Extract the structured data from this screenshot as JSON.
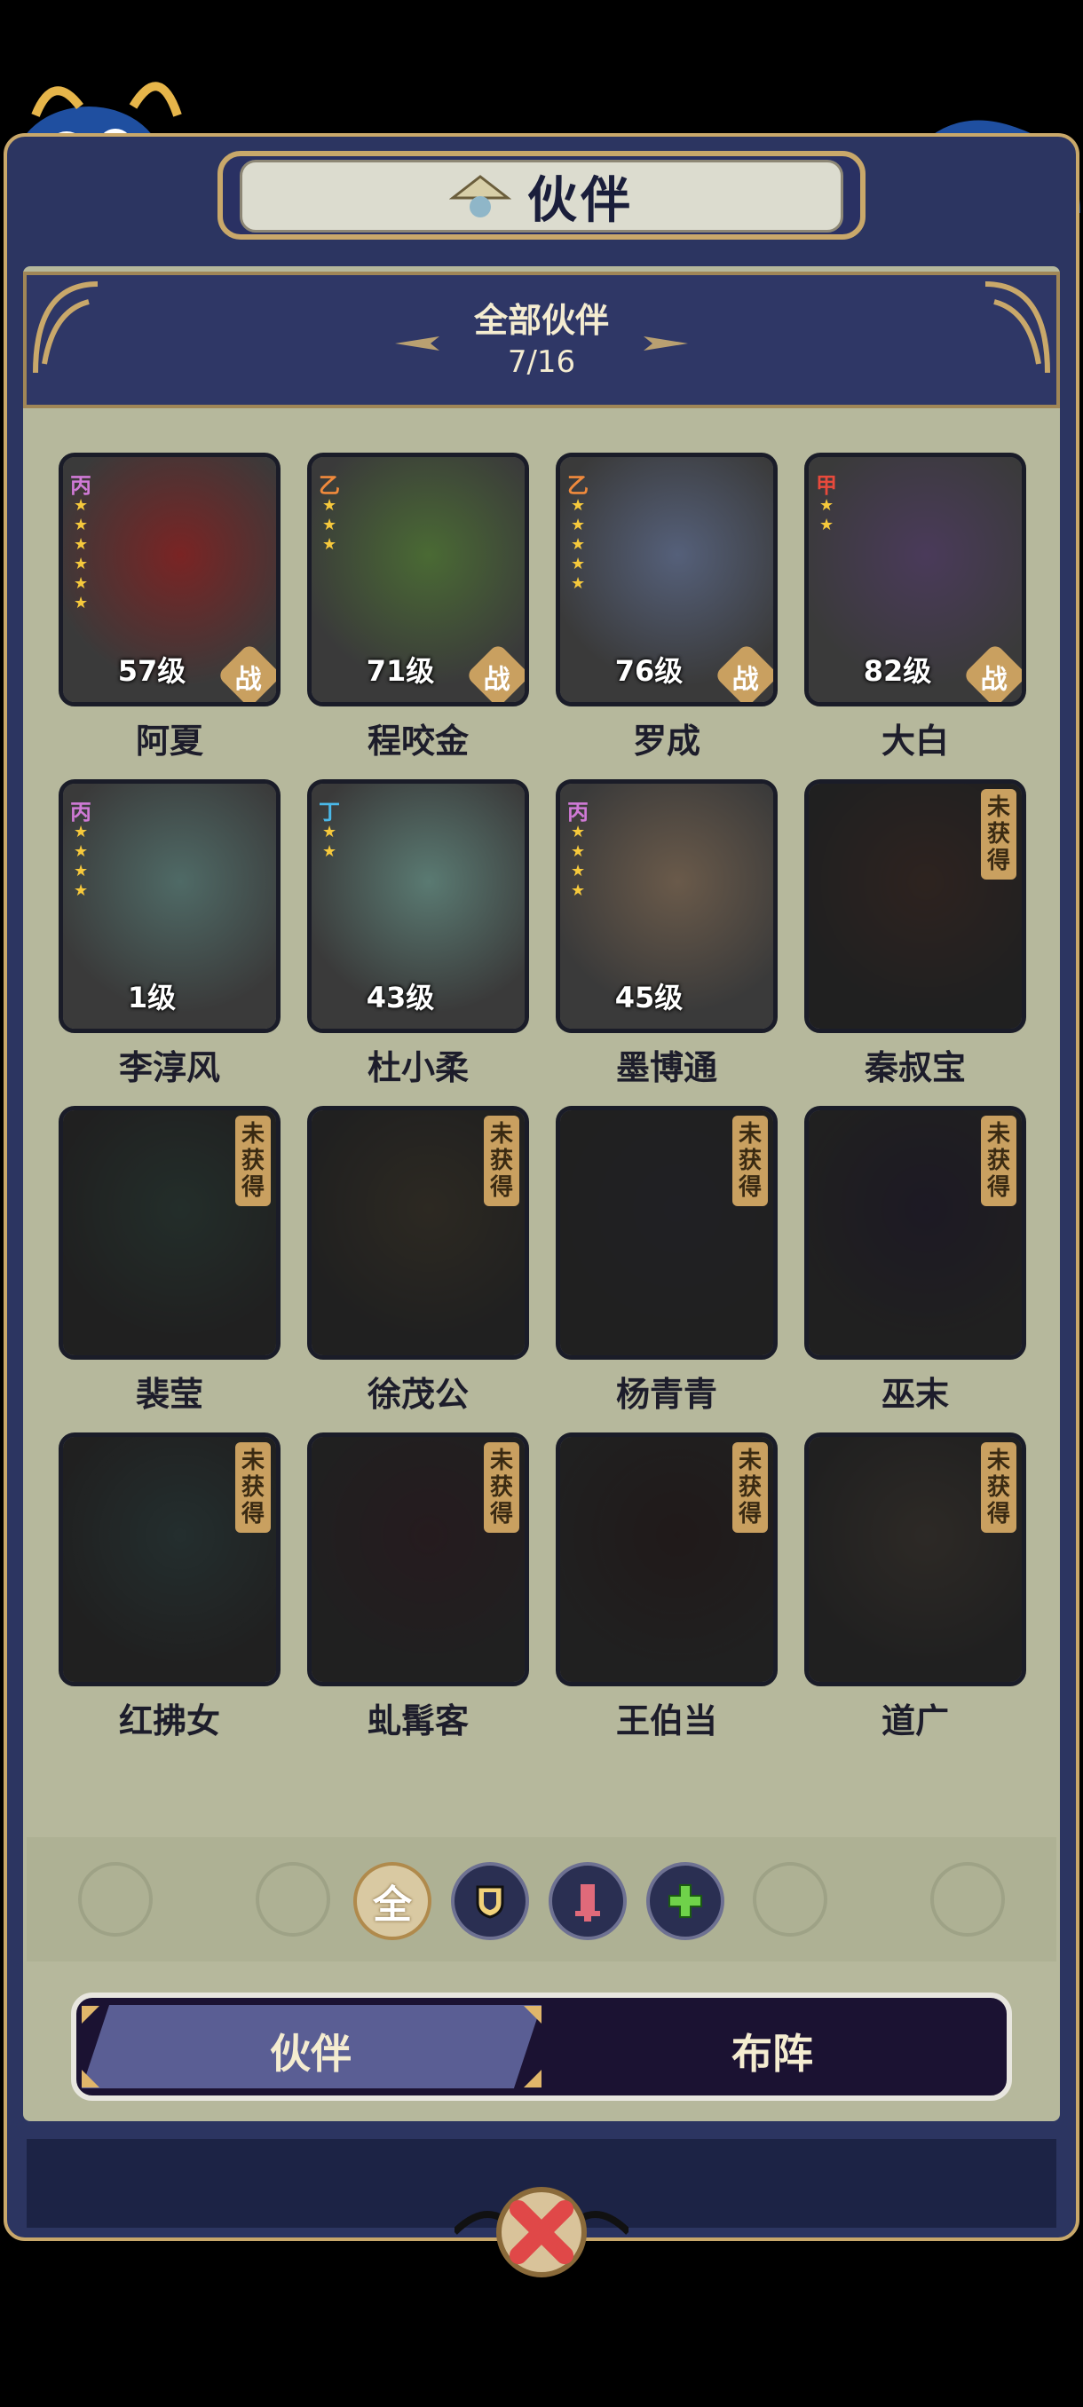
{
  "header": {
    "title": "伙伴"
  },
  "banner": {
    "title": "全部伙伴",
    "count": "7/16"
  },
  "partners": [
    {
      "name": "阿夏",
      "rank": "丙",
      "rank_color": "#d07ad6",
      "stars": 6,
      "level": "57级",
      "battle": "战",
      "owned": true,
      "hue": "#7a2424"
    },
    {
      "name": "程咬金",
      "rank": "乙",
      "rank_color": "#f08a3c",
      "stars": 3,
      "level": "71级",
      "battle": "战",
      "owned": true,
      "hue": "#4a6a34"
    },
    {
      "name": "罗成",
      "rank": "乙",
      "rank_color": "#f08a3c",
      "stars": 5,
      "level": "76级",
      "battle": "战",
      "owned": true,
      "hue": "#55607a"
    },
    {
      "name": "大白",
      "rank": "甲",
      "rank_color": "#e84a3c",
      "stars": 2,
      "level": "82级",
      "battle": "战",
      "owned": true,
      "hue": "#4a3a5a"
    },
    {
      "name": "李淳风",
      "rank": "丙",
      "rank_color": "#d07ad6",
      "stars": 4,
      "level": "1级",
      "battle": "",
      "owned": true,
      "hue": "#4f6a66"
    },
    {
      "name": "杜小柔",
      "rank": "丁",
      "rank_color": "#4ab8e8",
      "stars": 2,
      "level": "43级",
      "battle": "",
      "owned": true,
      "hue": "#5a7a72"
    },
    {
      "name": "墨博通",
      "rank": "丙",
      "rank_color": "#d07ad6",
      "stars": 4,
      "level": "45级",
      "battle": "",
      "owned": true,
      "hue": "#6a5a4a"
    },
    {
      "name": "秦叔宝",
      "lock": "未获得",
      "owned": false,
      "hue": "#6a3a2a"
    },
    {
      "name": "裴莹",
      "lock": "未获得",
      "owned": false,
      "hue": "#2a5a4a"
    },
    {
      "name": "徐茂公",
      "lock": "未获得",
      "owned": false,
      "hue": "#5a4a2a"
    },
    {
      "name": "杨青青",
      "lock": "未获得",
      "owned": false,
      "hue": "#3a3a4a"
    },
    {
      "name": "巫末",
      "lock": "未获得",
      "owned": false,
      "hue": "#3a2a5a"
    },
    {
      "name": "红拂女",
      "lock": "未获得",
      "owned": false,
      "hue": "#2a5a5a"
    },
    {
      "name": "虬髯客",
      "lock": "未获得",
      "owned": false,
      "hue": "#5a2a3a"
    },
    {
      "name": "王伯当",
      "lock": "未获得",
      "owned": false,
      "hue": "#4a2a2a"
    },
    {
      "name": "道广",
      "lock": "未获得",
      "owned": false,
      "hue": "#5a4a3a"
    }
  ],
  "filters": [
    {
      "label": "全",
      "icon": "all-icon",
      "active": true
    },
    {
      "label": "",
      "icon": "shield-icon",
      "active": false
    },
    {
      "label": "",
      "icon": "sword-icon",
      "active": false
    },
    {
      "label": "",
      "icon": "plus-icon",
      "active": false
    }
  ],
  "tabs": {
    "partners": "伙伴",
    "formation": "布阵"
  }
}
